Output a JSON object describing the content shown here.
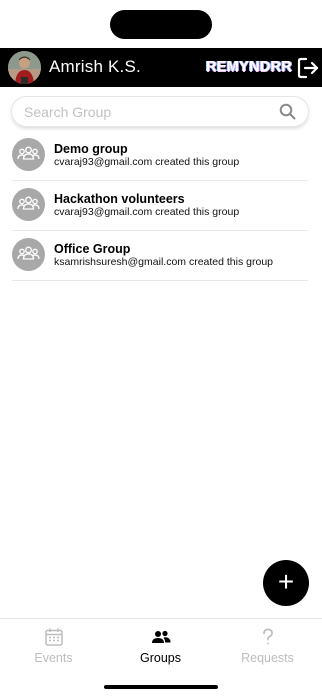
{
  "header": {
    "user_name": "Amrish K.S.",
    "brand": "REMYNDRR",
    "logout_icon": "logout-icon"
  },
  "search": {
    "placeholder": "Search Group",
    "value": "",
    "icon": "search-icon"
  },
  "groups": [
    {
      "name": "Demo group",
      "subtitle": "cvaraj93@gmail.com created this group"
    },
    {
      "name": "Hackathon volunteers",
      "subtitle": "cvaraj93@gmail.com created this group"
    },
    {
      "name": "Office Group",
      "subtitle": "ksamrishsuresh@gmail.com created this group"
    }
  ],
  "fab": {
    "label": "+",
    "icon": "plus-icon"
  },
  "tabs": [
    {
      "label": "Events",
      "icon": "calendar-icon",
      "active": false
    },
    {
      "label": "Groups",
      "icon": "people-icon",
      "active": true
    },
    {
      "label": "Requests",
      "icon": "question-icon",
      "active": false
    }
  ],
  "colors": {
    "header_bg": "#000000",
    "active_tab": "#000000",
    "inactive_tab": "#bdbdbd",
    "group_avatar": "#a8a8a8"
  }
}
